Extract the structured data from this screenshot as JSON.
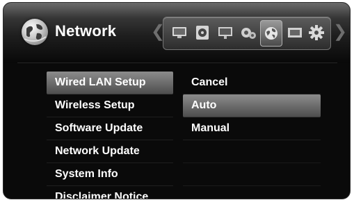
{
  "header": {
    "title": "Network",
    "title_icon": "network-globe-icon",
    "nav_left_glyph": "❮",
    "nav_right_glyph": "❯"
  },
  "iconbar": {
    "icons": [
      "tv-icon",
      "disc-icon",
      "movie-icon",
      "settings-gears-icon",
      "network-globe-icon",
      "film-icon",
      "gear-icon"
    ],
    "selected": "network-globe-icon"
  },
  "left_menu": {
    "items": [
      "Wired LAN Setup",
      "Wireless Setup",
      "Software Update",
      "Network Update",
      "System Info",
      "Disclaimer Notice"
    ],
    "highlighted": "Wired LAN Setup"
  },
  "right_menu": {
    "items": [
      "Cancel",
      "Auto",
      "Manual"
    ],
    "highlighted": "Auto"
  },
  "colors": {
    "highlight": "#8c8c8c",
    "background": "#0a0a0a",
    "text": "#ffffff"
  }
}
